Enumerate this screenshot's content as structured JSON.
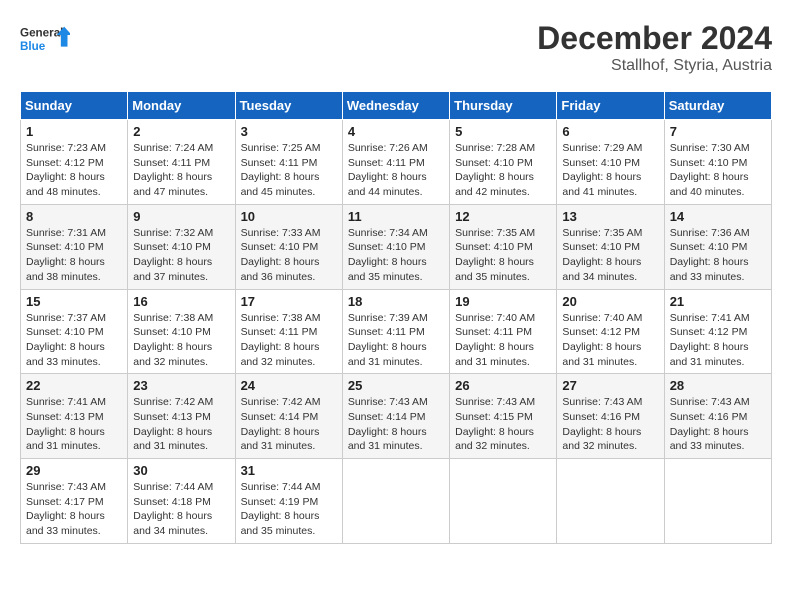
{
  "logo": {
    "general": "General",
    "blue": "Blue"
  },
  "header": {
    "month": "December 2024",
    "location": "Stallhof, Styria, Austria"
  },
  "weekdays": [
    "Sunday",
    "Monday",
    "Tuesday",
    "Wednesday",
    "Thursday",
    "Friday",
    "Saturday"
  ],
  "weeks": [
    [
      {
        "day": "1",
        "sunrise": "7:23 AM",
        "sunset": "4:12 PM",
        "daylight": "8 hours and 48 minutes."
      },
      {
        "day": "2",
        "sunrise": "7:24 AM",
        "sunset": "4:11 PM",
        "daylight": "8 hours and 47 minutes."
      },
      {
        "day": "3",
        "sunrise": "7:25 AM",
        "sunset": "4:11 PM",
        "daylight": "8 hours and 45 minutes."
      },
      {
        "day": "4",
        "sunrise": "7:26 AM",
        "sunset": "4:11 PM",
        "daylight": "8 hours and 44 minutes."
      },
      {
        "day": "5",
        "sunrise": "7:28 AM",
        "sunset": "4:10 PM",
        "daylight": "8 hours and 42 minutes."
      },
      {
        "day": "6",
        "sunrise": "7:29 AM",
        "sunset": "4:10 PM",
        "daylight": "8 hours and 41 minutes."
      },
      {
        "day": "7",
        "sunrise": "7:30 AM",
        "sunset": "4:10 PM",
        "daylight": "8 hours and 40 minutes."
      }
    ],
    [
      {
        "day": "8",
        "sunrise": "7:31 AM",
        "sunset": "4:10 PM",
        "daylight": "8 hours and 38 minutes."
      },
      {
        "day": "9",
        "sunrise": "7:32 AM",
        "sunset": "4:10 PM",
        "daylight": "8 hours and 37 minutes."
      },
      {
        "day": "10",
        "sunrise": "7:33 AM",
        "sunset": "4:10 PM",
        "daylight": "8 hours and 36 minutes."
      },
      {
        "day": "11",
        "sunrise": "7:34 AM",
        "sunset": "4:10 PM",
        "daylight": "8 hours and 35 minutes."
      },
      {
        "day": "12",
        "sunrise": "7:35 AM",
        "sunset": "4:10 PM",
        "daylight": "8 hours and 35 minutes."
      },
      {
        "day": "13",
        "sunrise": "7:35 AM",
        "sunset": "4:10 PM",
        "daylight": "8 hours and 34 minutes."
      },
      {
        "day": "14",
        "sunrise": "7:36 AM",
        "sunset": "4:10 PM",
        "daylight": "8 hours and 33 minutes."
      }
    ],
    [
      {
        "day": "15",
        "sunrise": "7:37 AM",
        "sunset": "4:10 PM",
        "daylight": "8 hours and 33 minutes."
      },
      {
        "day": "16",
        "sunrise": "7:38 AM",
        "sunset": "4:10 PM",
        "daylight": "8 hours and 32 minutes."
      },
      {
        "day": "17",
        "sunrise": "7:38 AM",
        "sunset": "4:11 PM",
        "daylight": "8 hours and 32 minutes."
      },
      {
        "day": "18",
        "sunrise": "7:39 AM",
        "sunset": "4:11 PM",
        "daylight": "8 hours and 31 minutes."
      },
      {
        "day": "19",
        "sunrise": "7:40 AM",
        "sunset": "4:11 PM",
        "daylight": "8 hours and 31 minutes."
      },
      {
        "day": "20",
        "sunrise": "7:40 AM",
        "sunset": "4:12 PM",
        "daylight": "8 hours and 31 minutes."
      },
      {
        "day": "21",
        "sunrise": "7:41 AM",
        "sunset": "4:12 PM",
        "daylight": "8 hours and 31 minutes."
      }
    ],
    [
      {
        "day": "22",
        "sunrise": "7:41 AM",
        "sunset": "4:13 PM",
        "daylight": "8 hours and 31 minutes."
      },
      {
        "day": "23",
        "sunrise": "7:42 AM",
        "sunset": "4:13 PM",
        "daylight": "8 hours and 31 minutes."
      },
      {
        "day": "24",
        "sunrise": "7:42 AM",
        "sunset": "4:14 PM",
        "daylight": "8 hours and 31 minutes."
      },
      {
        "day": "25",
        "sunrise": "7:43 AM",
        "sunset": "4:14 PM",
        "daylight": "8 hours and 31 minutes."
      },
      {
        "day": "26",
        "sunrise": "7:43 AM",
        "sunset": "4:15 PM",
        "daylight": "8 hours and 32 minutes."
      },
      {
        "day": "27",
        "sunrise": "7:43 AM",
        "sunset": "4:16 PM",
        "daylight": "8 hours and 32 minutes."
      },
      {
        "day": "28",
        "sunrise": "7:43 AM",
        "sunset": "4:16 PM",
        "daylight": "8 hours and 33 minutes."
      }
    ],
    [
      {
        "day": "29",
        "sunrise": "7:43 AM",
        "sunset": "4:17 PM",
        "daylight": "8 hours and 33 minutes."
      },
      {
        "day": "30",
        "sunrise": "7:44 AM",
        "sunset": "4:18 PM",
        "daylight": "8 hours and 34 minutes."
      },
      {
        "day": "31",
        "sunrise": "7:44 AM",
        "sunset": "4:19 PM",
        "daylight": "8 hours and 35 minutes."
      },
      null,
      null,
      null,
      null
    ]
  ]
}
